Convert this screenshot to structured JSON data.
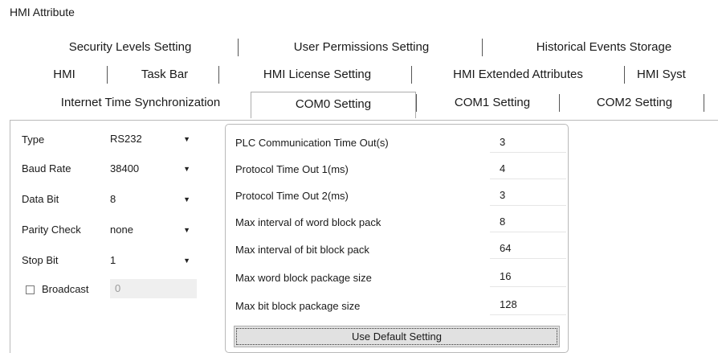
{
  "window": {
    "title": "HMI Attribute"
  },
  "tabs": {
    "row1": [
      "Security Levels Setting",
      "User Permissions Setting",
      "Historical Events Storage"
    ],
    "row2": [
      "HMI",
      "Task Bar",
      "HMI License Setting",
      "HMI Extended Attributes",
      "HMI Syst"
    ],
    "row3": [
      "Internet Time Synchronization",
      "COM0 Setting",
      "COM1 Setting",
      "COM2 Setting"
    ],
    "active": "COM0 Setting"
  },
  "serial": {
    "type": {
      "label": "Type",
      "value": "RS232"
    },
    "baud": {
      "label": "Baud Rate",
      "value": "38400"
    },
    "databit": {
      "label": "Data Bit",
      "value": "8"
    },
    "parity": {
      "label": "Parity Check",
      "value": "none"
    },
    "stopbit": {
      "label": "Stop Bit",
      "value": "1"
    },
    "broadcast": {
      "label": "Broadcast",
      "checked": false,
      "value": "0"
    }
  },
  "params": [
    {
      "label": "PLC Communication Time Out(s)",
      "value": "3"
    },
    {
      "label": "Protocol Time Out 1(ms)",
      "value": "4"
    },
    {
      "label": "Protocol Time Out 2(ms)",
      "value": "3"
    },
    {
      "label": "Max interval of word block pack",
      "value": "8"
    },
    {
      "label": "Max interval of bit block pack",
      "value": "64"
    },
    {
      "label": "Max word block package size",
      "value": "16"
    },
    {
      "label": "Max bit block package size",
      "value": "128"
    }
  ],
  "buttons": {
    "default_label": "Use Default Setting"
  },
  "icons": {
    "dropdown": "chevron-down-icon",
    "checkbox": "checkbox-icon"
  }
}
